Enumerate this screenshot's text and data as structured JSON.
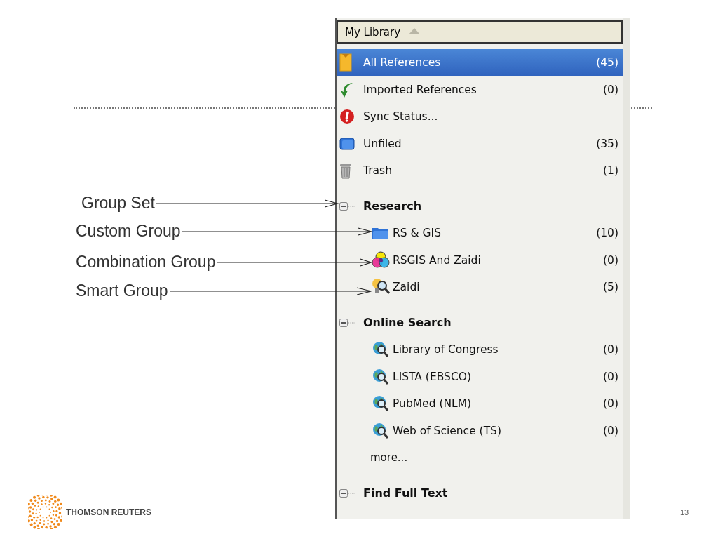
{
  "slide": {
    "page_number": "13",
    "logo_text": "THOMSON REUTERS"
  },
  "callouts": [
    "Group Set",
    "Custom Group",
    "Combination Group",
    "Smart Group"
  ],
  "panel": {
    "header": {
      "title": "My Library"
    },
    "library_items": [
      {
        "kind": "all",
        "label": "All References",
        "count": "(45)",
        "selected": true
      },
      {
        "kind": "imported",
        "label": "Imported References",
        "count": "(0)",
        "selected": false
      },
      {
        "kind": "sync",
        "label": "Sync Status...",
        "selected": false
      },
      {
        "kind": "unfiled",
        "label": "Unfiled",
        "count": "(35)",
        "selected": false
      },
      {
        "kind": "trash",
        "label": "Trash",
        "count": "(1)",
        "selected": false
      }
    ],
    "groups": [
      {
        "title": "Research",
        "expanded": true,
        "children": [
          {
            "kind": "custom",
            "label": "RS & GIS",
            "count": "(10)",
            "selected": false
          },
          {
            "kind": "combination",
            "label": "RSGIS And Zaidi",
            "count": "(0)",
            "selected": false
          },
          {
            "kind": "smart",
            "label": "Zaidi",
            "count": "(5)",
            "selected": false
          }
        ]
      },
      {
        "title": "Online Search",
        "expanded": true,
        "children": [
          {
            "kind": "online",
            "label": "Library of Congress",
            "count": "(0)",
            "selected": false
          },
          {
            "kind": "online",
            "label": "LISTA (EBSCO)",
            "count": "(0)",
            "selected": false
          },
          {
            "kind": "online",
            "label": "PubMed (NLM)",
            "count": "(0)",
            "selected": false
          },
          {
            "kind": "online",
            "label": "Web of Science (TS)",
            "count": "(0)",
            "selected": false
          }
        ],
        "more": "more..."
      },
      {
        "title": "Find Full Text",
        "expanded": true
      }
    ]
  }
}
